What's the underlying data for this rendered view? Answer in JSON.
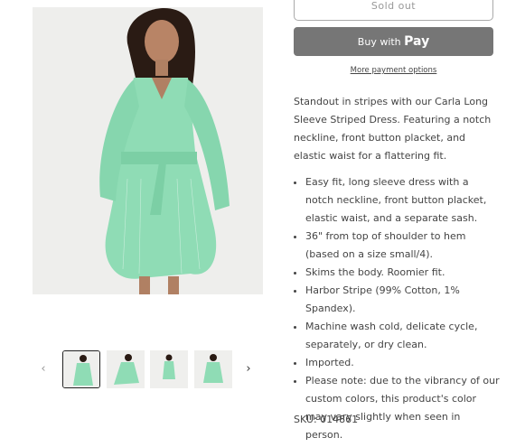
{
  "product": {
    "sold_out_label": "Sold out",
    "buy_with_label": "Buy with",
    "pay_brand_label": "Pay",
    "more_payment_options": "More payment options",
    "description": "Standout in stripes with our Carla Long Sleeve Striped Dress. Featuring a notch neckline, front button placket, and elastic waist for a flattering fit.",
    "features": [
      "Easy fit, long sleeve dress with a notch neckline, front button placket, elastic waist, and a separate sash.",
      "36\" from top of shoulder to hem (based on a size small/4).",
      "Skims the body. Roomier fit.",
      "Harbor Stripe (99% Cotton, 1% Spandex).",
      "Machine wash cold, delicate cycle, separately, or dry clean.",
      "Imported.",
      "Please note: due to the vibrancy of our custom colors, this product's color may vary slightly when seen in person."
    ],
    "sku": "SKU: 014861"
  },
  "gallery": {
    "prev_icon": "‹",
    "next_icon": "›",
    "thumbnails": 4,
    "active_index": 0
  },
  "colors": {
    "dress": "#8fdcb5",
    "pay_button": "#767676",
    "image_bg": "#eeeeec"
  }
}
